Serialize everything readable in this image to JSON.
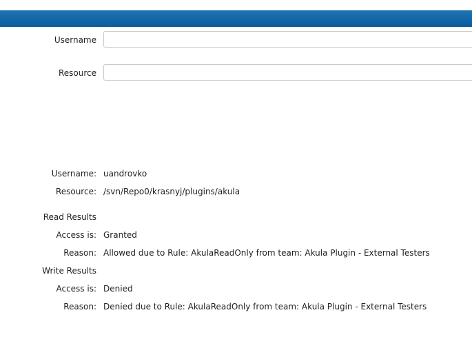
{
  "form": {
    "username_label": "Username",
    "username_value": "",
    "resource_label": "Resource",
    "resource_value": ""
  },
  "summary": {
    "username_label": "Username:",
    "username_value": "uandrovko",
    "resource_label": "Resource:",
    "resource_value": "/svn/Repo0/krasnyj/plugins/akula"
  },
  "read_results": {
    "heading": "Read Results",
    "access_label": "Access is:",
    "access_value": "Granted",
    "reason_label": "Reason:",
    "reason_value": "Allowed due to Rule: AkulaReadOnly from team: Akula Plugin - External Testers"
  },
  "write_results": {
    "heading": "Write Results",
    "access_label": "Access is:",
    "access_value": "Denied",
    "reason_label": "Reason:",
    "reason_value": "Denied due to Rule: AkulaReadOnly from team: Akula Plugin - External Testers"
  }
}
